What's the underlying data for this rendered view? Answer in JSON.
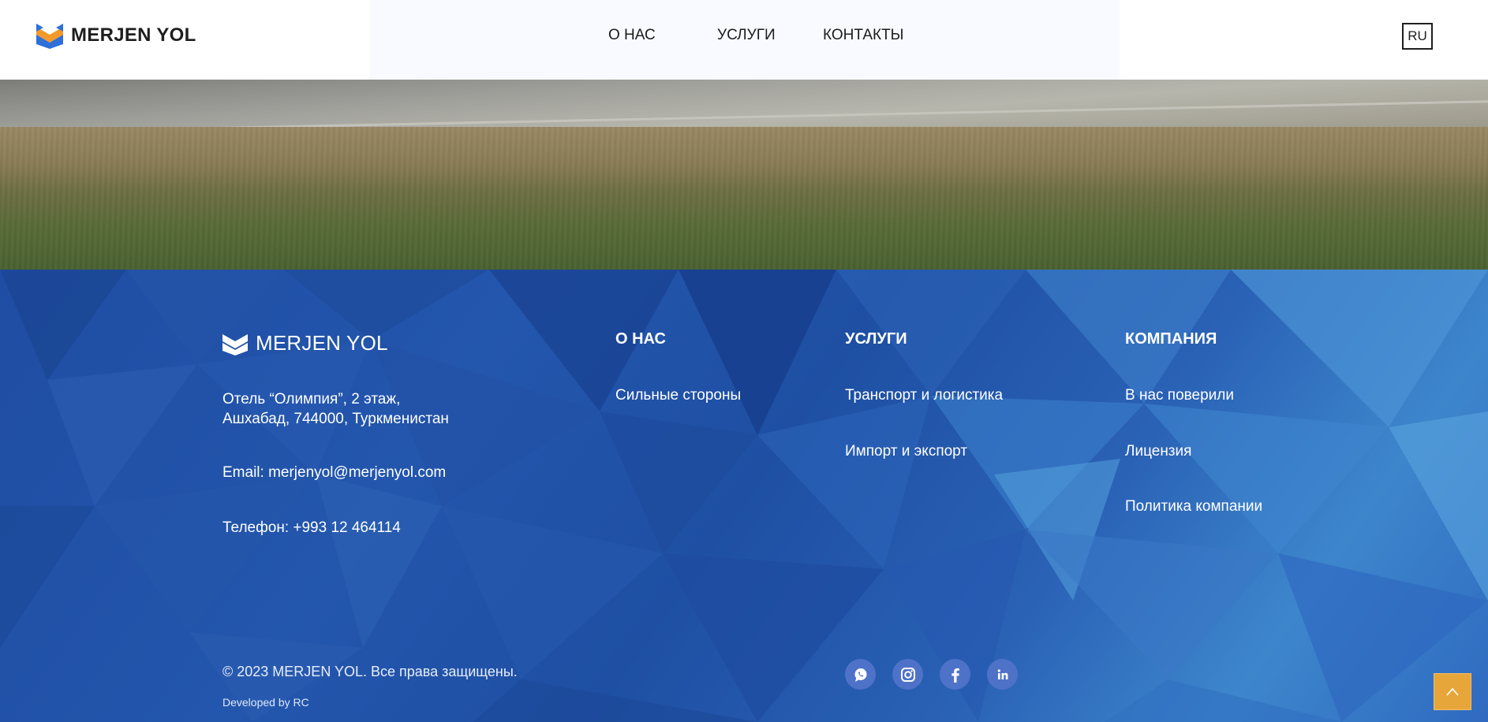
{
  "header": {
    "logo_text": "MERJEN YOL",
    "nav": [
      "О НАС",
      "УСЛУГИ",
      "КОНТАКТЫ"
    ],
    "lang": "RU"
  },
  "footer": {
    "logo_text": "MERJEN YOL",
    "address_line1": "Отель “Олимпия”, 2 этаж,",
    "address_line2": "Ашхабад, 744000, Туркменистан",
    "email": "Email: merjenyol@merjenyol.com",
    "phone": "Телефон: +993 12 464114",
    "columns": [
      {
        "title": "О НАС",
        "links": [
          "Сильные стороны"
        ]
      },
      {
        "title": "УСЛУГИ",
        "links": [
          "Транспорт и логистика",
          "Импорт и экспорт"
        ]
      },
      {
        "title": "КОМПАНИЯ",
        "links": [
          "В нас поверили",
          "Лицензия",
          "Политика компании"
        ]
      }
    ],
    "copyright": "© 2023 MERJEN YOL. Все права защищены.",
    "developed_by": "Developed by RC",
    "social": [
      "whatsapp-icon",
      "instagram-icon",
      "facebook-icon",
      "linkedin-icon"
    ]
  },
  "colors": {
    "logo_orange": "#f39a2b",
    "logo_blue": "#2e6fd8",
    "footer_blue": "#1f4fa3",
    "scroll_top": "#e7a63a"
  },
  "scroll_top_icon": "chevron-up-icon"
}
